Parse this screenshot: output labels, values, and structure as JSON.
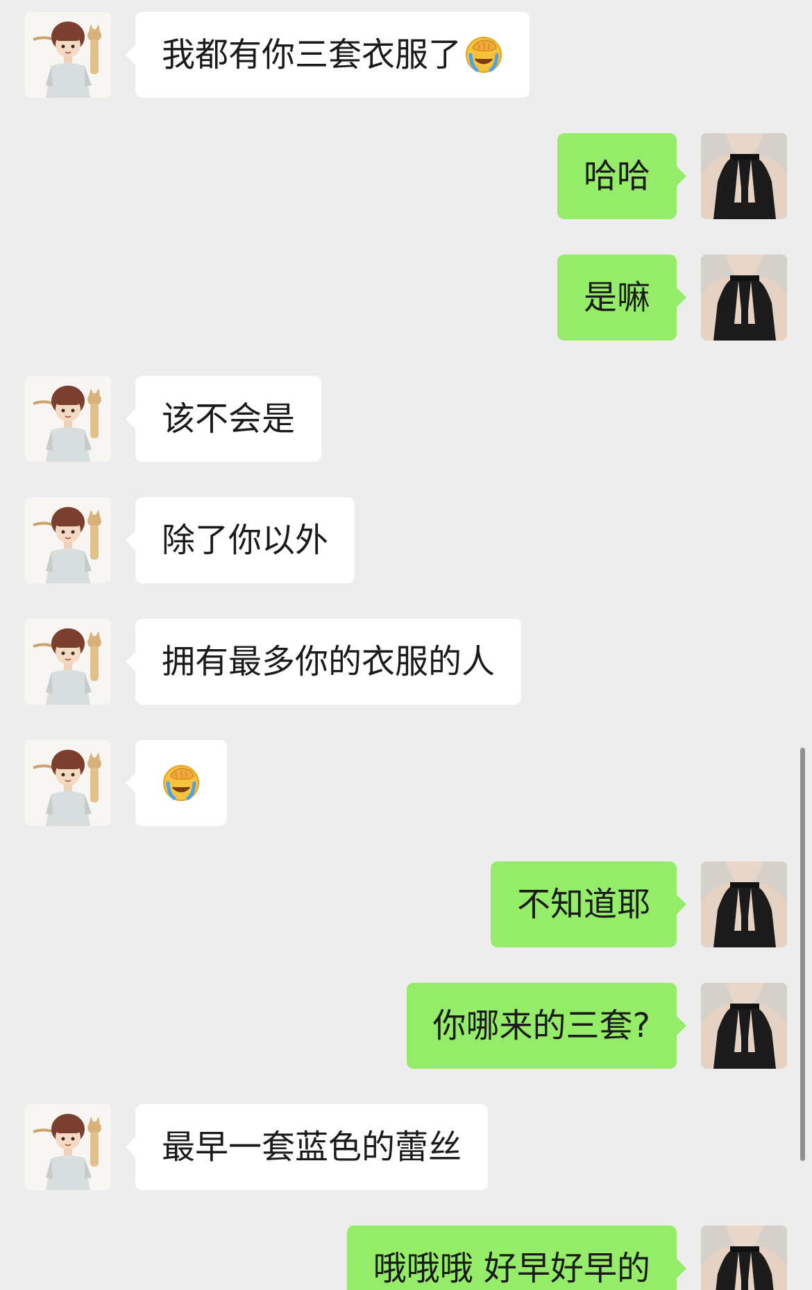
{
  "messages": [
    {
      "side": "left",
      "text": "我都有你三套衣服了",
      "emoji": "facepalm-crying-emoji"
    },
    {
      "side": "right",
      "text": "哈哈"
    },
    {
      "side": "right",
      "text": "是嘛"
    },
    {
      "side": "left",
      "text": "该不会是"
    },
    {
      "side": "left",
      "text": "除了你以外"
    },
    {
      "side": "left",
      "text": "拥有最多你的衣服的人"
    },
    {
      "side": "left",
      "text": "",
      "emoji": "facepalm-crying-emoji"
    },
    {
      "side": "right",
      "text": "不知道耶"
    },
    {
      "side": "right",
      "text": "你哪来的三套?"
    },
    {
      "side": "left",
      "text": "最早一套蓝色的蕾丝"
    },
    {
      "side": "right",
      "text": "哦哦哦 好早好早的"
    }
  ],
  "avatars": {
    "left": "boy-with-cat-avatar",
    "right": "black-top-avatar"
  },
  "colors": {
    "background": "#ededed",
    "incoming_bubble": "#ffffff",
    "outgoing_bubble": "#95ec69",
    "text": "#1a1a1a"
  }
}
